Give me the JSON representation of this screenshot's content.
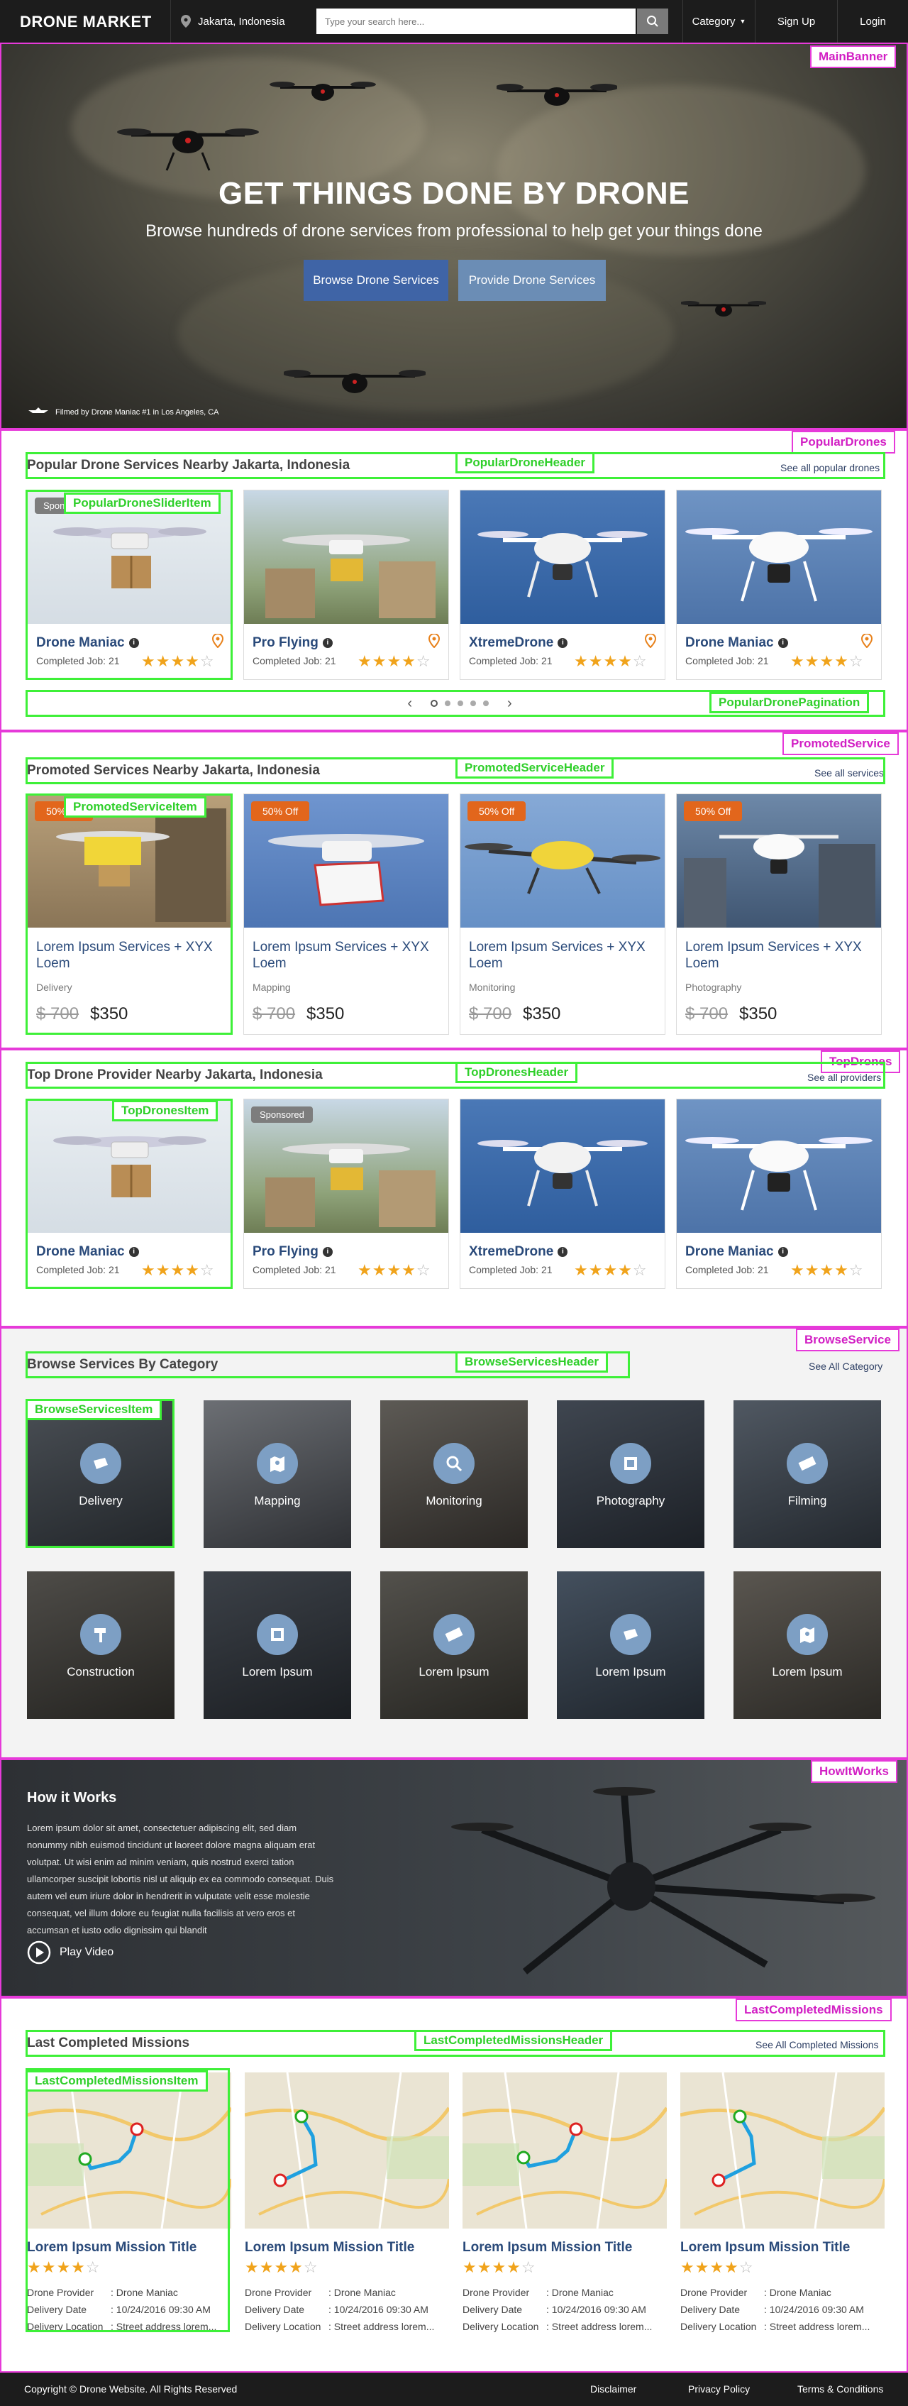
{
  "nav": {
    "logo": "DRONE MARKET",
    "location": "Jakarta, Indonesia",
    "search_placeholder": "Type your search here...",
    "category": "Category",
    "signup": "Sign Up",
    "login": "Login"
  },
  "hero": {
    "title": "GET THINGS DONE BY DRONE",
    "subtitle": "Browse hundreds of drone services from professional to help get your things done",
    "browse_btn": "Browse Drone Services",
    "provide_btn": "Provide Drone Services",
    "credit": "Filmed by Drone Maniac #1 in Los Angeles, CA"
  },
  "annotations": {
    "main_banner": "MainBanner",
    "popular_drones": "PopularDrones",
    "popular_header": "PopularDroneHeader",
    "popular_item": "PopularDroneSliderItem",
    "popular_pagination": "PopularDronePagination",
    "promoted_service": "PromotedService",
    "promoted_header": "PromotedServiceHeader",
    "promoted_item": "PromotedServiceItem",
    "top_drones": "TopDrones",
    "top_header": "TopDronesHeader",
    "top_item": "TopDronesItem",
    "browse_service": "BrowseService",
    "browse_header": "BrowseServicesHeader",
    "browse_item": "BrowseServicesItem",
    "how_it_works": "HowItWorks",
    "last_missions": "LastCompletedMissions",
    "last_header": "LastCompletedMissionsHeader",
    "last_item": "LastCompletedMissionsItem"
  },
  "popular": {
    "title": "Popular Drone Services Nearby Jakarta, Indonesia",
    "link": "See all popular drones",
    "items": [
      {
        "name": "Drone Maniac",
        "job": "Completed Job: 21",
        "badge": "Sponsored",
        "rating": 4
      },
      {
        "name": "Pro Flying",
        "job": "Completed Job: 21",
        "rating": 4
      },
      {
        "name": "XtremeDrone",
        "job": "Completed Job: 21",
        "rating": 4
      },
      {
        "name": "Drone Maniac",
        "job": "Completed Job: 21",
        "rating": 4
      }
    ]
  },
  "promoted": {
    "title": "Promoted Services Nearby Jakarta, Indonesia",
    "link": "See all services",
    "items": [
      {
        "badge": "50% Off",
        "title": "Lorem Ipsum Services + XYX Loem",
        "category": "Delivery",
        "old_price": "$ 700",
        "price": "$350"
      },
      {
        "badge": "50% Off",
        "title": "Lorem Ipsum Services + XYX Loem",
        "category": "Mapping",
        "old_price": "$ 700",
        "price": "$350"
      },
      {
        "badge": "50% Off",
        "title": "Lorem Ipsum Services + XYX Loem",
        "category": "Monitoring",
        "old_price": "$ 700",
        "price": "$350"
      },
      {
        "badge": "50% Off",
        "title": "Lorem Ipsum Services + XYX Loem",
        "category": "Photography",
        "old_price": "$ 700",
        "price": "$350"
      }
    ]
  },
  "top": {
    "title": "Top Drone Provider Nearby Jakarta, Indonesia",
    "link": "See all providers",
    "items": [
      {
        "name": "Drone Maniac",
        "job": "Completed Job: 21",
        "rating": 4
      },
      {
        "name": "Pro Flying",
        "job": "Completed Job: 21",
        "badge": "Sponsored",
        "rating": 4
      },
      {
        "name": "XtremeDrone",
        "job": "Completed Job: 21",
        "rating": 4
      },
      {
        "name": "Drone Maniac",
        "job": "Completed Job: 21",
        "rating": 4
      }
    ]
  },
  "browse": {
    "title": "Browse Services By Category",
    "link": "See All Category",
    "items": [
      {
        "label": "Delivery",
        "icon": "box-icon"
      },
      {
        "label": "Mapping",
        "icon": "map-pin-icon"
      },
      {
        "label": "Monitoring",
        "icon": "search-icon"
      },
      {
        "label": "Photography",
        "icon": "camera-icon"
      },
      {
        "label": "Filming",
        "icon": "film-icon"
      },
      {
        "label": "Construction",
        "icon": "hammer-icon"
      },
      {
        "label": "Lorem Ipsum",
        "icon": "camera-icon"
      },
      {
        "label": "Lorem Ipsum",
        "icon": "film-icon"
      },
      {
        "label": "Lorem Ipsum",
        "icon": "box-icon"
      },
      {
        "label": "Lorem Ipsum",
        "icon": "map-pin-icon"
      }
    ]
  },
  "how": {
    "title": "How it Works",
    "body": "Lorem ipsum dolor sit amet, consectetuer adipiscing elit, sed diam nonummy nibh euismod tincidunt ut laoreet dolore magna aliquam erat volutpat. Ut wisi enim ad minim veniam, quis nostrud exerci tation ullamcorper suscipit lobortis nisl ut aliquip ex ea commodo consequat. Duis autem vel eum iriure dolor in hendrerit in vulputate velit esse molestie consequat, vel illum dolore eu feugiat nulla facilisis at vero eros et accumsan et iusto odio dignissim qui blandit",
    "play": "Play Video"
  },
  "missions": {
    "title": "Last Completed Missions",
    "link": "See All Completed Missions",
    "items": [
      {
        "title": "Lorem Ipsum Mission Title",
        "rating": 4,
        "provider_label": "Drone Provider",
        "provider": ": Drone Maniac",
        "date_label": "Delivery Date",
        "date": ": 10/24/2016  09:30 AM",
        "loc_label": "Delivery Location",
        "loc": ": Street address lorem..."
      },
      {
        "title": "Lorem Ipsum Mission Title",
        "rating": 4,
        "provider_label": "Drone Provider",
        "provider": ": Drone Maniac",
        "date_label": "Delivery Date",
        "date": ": 10/24/2016  09:30 AM",
        "loc_label": "Delivery Location",
        "loc": ": Street address lorem..."
      },
      {
        "title": "Lorem Ipsum Mission Title",
        "rating": 4,
        "provider_label": "Drone Provider",
        "provider": ": Drone Maniac",
        "date_label": "Delivery Date",
        "date": ": 10/24/2016  09:30 AM",
        "loc_label": "Delivery Location",
        "loc": ": Street address lorem..."
      },
      {
        "title": "Lorem Ipsum Mission Title",
        "rating": 4,
        "provider_label": "Drone Provider",
        "provider": ": Drone Maniac",
        "date_label": "Delivery Date",
        "date": ": 10/24/2016  09:30 AM",
        "loc_label": "Delivery Location",
        "loc": ": Street address lorem..."
      }
    ]
  },
  "footer": {
    "copyright": "Copyright © Drone Website. All Rights Reserved",
    "disclaimer": "Disclaimer",
    "privacy": "Privacy Policy",
    "terms": "Terms & Conditions"
  },
  "colors": {
    "annotation_magenta": "#e63ad9",
    "annotation_green": "#3ef038",
    "primary_blue": "#3f64a6",
    "secondary_blue": "#6b8db5",
    "badge_orange": "#e2661c",
    "star": "#f0a31b"
  }
}
